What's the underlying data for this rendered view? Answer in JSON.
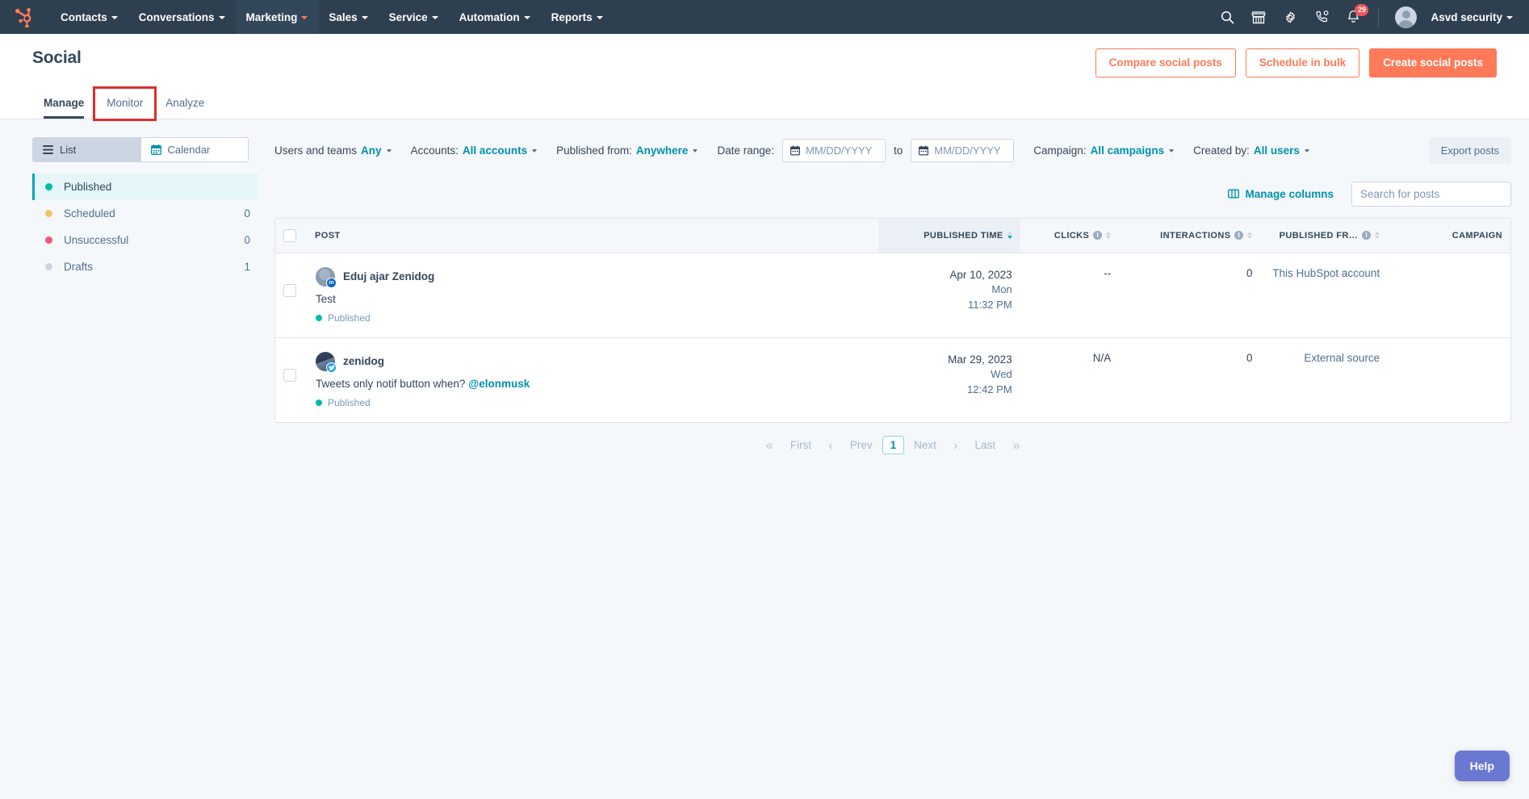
{
  "topnav": {
    "logo": "hubspot-sprocket-logo",
    "items": [
      {
        "label": "Contacts",
        "active": false
      },
      {
        "label": "Conversations",
        "active": false
      },
      {
        "label": "Marketing",
        "active": true
      },
      {
        "label": "Sales",
        "active": false
      },
      {
        "label": "Service",
        "active": false
      },
      {
        "label": "Automation",
        "active": false
      },
      {
        "label": "Reports",
        "active": false
      }
    ],
    "icons": [
      "search-icon",
      "marketplace-icon",
      "gear-icon",
      "call-icon",
      "notifications-icon"
    ],
    "notification_count": "29",
    "account_name": "Asvd security"
  },
  "header": {
    "title": "Social",
    "buttons": {
      "compare": "Compare social posts",
      "schedule": "Schedule in bulk",
      "create": "Create social posts"
    },
    "tabs": [
      {
        "label": "Manage",
        "active": true,
        "highlighted": false
      },
      {
        "label": "Monitor",
        "active": false,
        "highlighted": true
      },
      {
        "label": "Analyze",
        "active": false,
        "highlighted": false
      }
    ]
  },
  "sidebar": {
    "view_toggle": [
      {
        "label": "List",
        "icon": "list-icon",
        "active": true
      },
      {
        "label": "Calendar",
        "icon": "calendar-icon",
        "active": false
      }
    ],
    "statuses": [
      {
        "label": "Published",
        "count": "",
        "color": "#00bda5",
        "active": true
      },
      {
        "label": "Scheduled",
        "count": "0",
        "color": "#f5c26b",
        "active": false
      },
      {
        "label": "Unsuccessful",
        "count": "0",
        "color": "#f2547d",
        "active": false
      },
      {
        "label": "Drafts",
        "count": "1",
        "color": "#cbd6e2",
        "active": false
      }
    ]
  },
  "filters": [
    {
      "label": "Users and teams",
      "value": "Any",
      "has_colon": false
    },
    {
      "label": "Accounts:",
      "value": "All accounts",
      "has_colon": true
    },
    {
      "label": "Published from:",
      "value": "Anywhere",
      "has_colon": true
    }
  ],
  "date_range": {
    "label": "Date range:",
    "from_placeholder": "MM/DD/YYYY",
    "from_value": "",
    "to_word": "to",
    "to_placeholder": "MM/DD/YYYY",
    "to_value": ""
  },
  "filters2": [
    {
      "label": "Campaign:",
      "value": "All campaigns"
    },
    {
      "label": "Created by:",
      "value": "All users"
    }
  ],
  "export_label": "Export posts",
  "tools": {
    "manage_columns": "Manage columns",
    "search_placeholder": "Search for posts",
    "search_value": ""
  },
  "table": {
    "columns": [
      {
        "label": "POST",
        "align": "left",
        "info": false,
        "sortable": false
      },
      {
        "label": "PUBLISHED TIME",
        "align": "right",
        "info": false,
        "sortable": true,
        "sorted": "desc"
      },
      {
        "label": "CLICKS",
        "align": "right",
        "info": true,
        "sortable": true
      },
      {
        "label": "INTERACTIONS",
        "align": "right",
        "info": true,
        "sortable": true
      },
      {
        "label": "PUBLISHED FR…",
        "align": "right",
        "info": true,
        "sortable": true
      },
      {
        "label": "CAMPAIGN",
        "align": "right",
        "info": false,
        "sortable": false
      }
    ],
    "rows": [
      {
        "network": "linkedin",
        "account": "Eduj ajar Zenidog",
        "text": "Test",
        "mention": "",
        "status": "Published",
        "date": "Apr 10, 2023",
        "weekday": "Mon",
        "time": "11:32 PM",
        "clicks": "--",
        "interactions": "0",
        "published_from": "This HubSpot account",
        "campaign": ""
      },
      {
        "network": "twitter",
        "account": "zenidog",
        "text": "Tweets only notif button when? ",
        "mention": "@elonmusk",
        "status": "Published",
        "date": "Mar 29, 2023",
        "weekday": "Wed",
        "time": "12:42 PM",
        "clicks": "N/A",
        "interactions": "0",
        "published_from": "External source",
        "campaign": ""
      }
    ]
  },
  "pagination": {
    "first": "First",
    "prev": "Prev",
    "current": "1",
    "next": "Next",
    "last": "Last"
  },
  "help": {
    "label": "Help"
  },
  "colors": {
    "nav_bg": "#2e3f50",
    "accent_orange": "#ff7a59",
    "link_teal": "#0091ae",
    "highlight_red": "#e02d2d",
    "page_bg": "#f5f8fa",
    "help_purple": "#6a78d1"
  }
}
